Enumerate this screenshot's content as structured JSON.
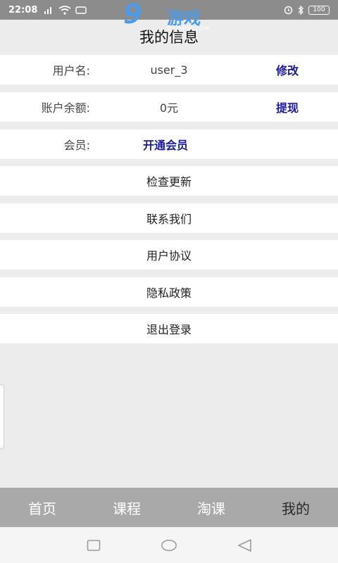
{
  "status_bar": {
    "time": "22:08",
    "battery": "100"
  },
  "watermark": {
    "number": "9",
    "brand": "游戏",
    "url": "91danji.com"
  },
  "header": {
    "title": "我的信息"
  },
  "profile": {
    "username_label": "用户名:",
    "username_value": "user_3",
    "username_action": "修改",
    "balance_label": "账户余额:",
    "balance_value": "0元",
    "balance_action": "提现",
    "member_label": "会员:",
    "member_action": "开通会员"
  },
  "menu": {
    "items": [
      "检查更新",
      "联系我们",
      "用户协议",
      "隐私政策",
      "退出登录"
    ]
  },
  "tabs": {
    "items": [
      "首页",
      "课程",
      "淘课",
      "我的"
    ],
    "active": "我的"
  },
  "colors": {
    "link": "#1a1aa0",
    "tab_bar": "#a9a9a9",
    "status_bar": "#8c8c8c",
    "background": "#ececec"
  }
}
